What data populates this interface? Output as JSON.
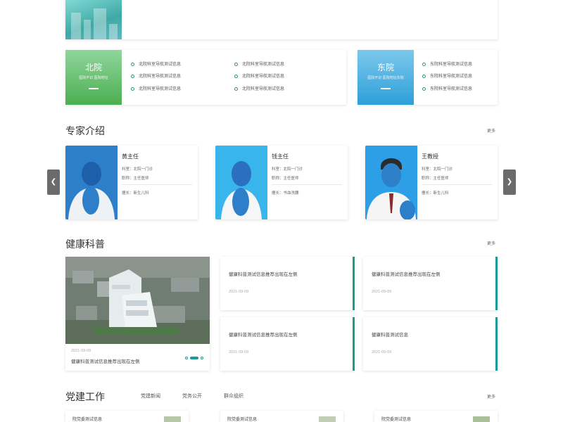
{
  "campuses": [
    {
      "name": "北院",
      "subtitle": "医院不识 医院地址",
      "color_top": "#8fd69c",
      "color_bottom": "#4caf50",
      "links": [
        "北院科室导航测试信息",
        "北院科室导航测试信息",
        "北院科室导航测试信息",
        "北院科室导航测试信息",
        "北院科室导航测试信息",
        "北院科室导航测试信息"
      ]
    },
    {
      "name": "东院",
      "subtitle": "医院不识 医院地址东院",
      "color_top": "#7cc8ec",
      "color_bottom": "#2d9fd8",
      "links": [
        "东院科室导航测试信息",
        "东院科室导航测试信息",
        "东院科室导航测试信息"
      ]
    }
  ],
  "experts": {
    "title": "专家介绍",
    "more": "更多",
    "prev_icon": "chevron-left-icon",
    "next_icon": "chevron-right-icon",
    "items": [
      {
        "name": "黄主任",
        "dept": "科室：北院一门诊",
        "title": "职称：主任医师",
        "specialty": "擅长：新生儿科",
        "bg": "#2e7fc9"
      },
      {
        "name": "钱主任",
        "dept": "科室：北院一门诊",
        "title": "职称：主任医师",
        "specialty": "擅长：书血洗腰",
        "bg": "#38b6ec"
      },
      {
        "name": "王教授",
        "dept": "科室：北院一门诊",
        "title": "职称：主任医师",
        "specialty": "擅长：新生儿科",
        "bg": "#2d9fe6"
      }
    ]
  },
  "health": {
    "title": "健康科普",
    "more": "更多",
    "featured": {
      "date": "2021-09-09",
      "title": "健康科普测试信息推荐出现在左侧"
    },
    "cards": [
      {
        "title": "健康科普测试信息推荐出现在左侧",
        "date": "2021-09-09"
      },
      {
        "title": "健康科普测试信息推荐出现在左侧",
        "date": "2021-09-09"
      },
      {
        "title": "健康科普测试信息推荐出现在左侧",
        "date": "2021-09-09"
      },
      {
        "title": "健康科普测试信息",
        "date": "2021-09-09"
      }
    ],
    "accent": "#1d9a96"
  },
  "party": {
    "title": "党建工作",
    "tabs": [
      "党建新闻",
      "党务公开",
      "群众组织"
    ],
    "more": "更多",
    "cards": [
      {
        "title": "院党委测试信息"
      },
      {
        "title": "院党委测试信息"
      },
      {
        "title": "院党委测试信息"
      }
    ]
  }
}
